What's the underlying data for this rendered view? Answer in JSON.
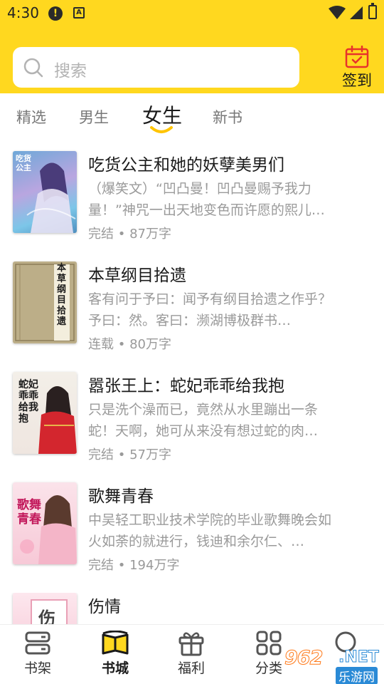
{
  "status_bar": {
    "time": "4:30",
    "alert_glyph": "!",
    "notify_glyph": "A"
  },
  "search": {
    "placeholder": "搜索",
    "icon": "search-icon"
  },
  "checkin": {
    "label": "签到",
    "icon": "calendar-check-icon"
  },
  "tabs": [
    {
      "label": "精选",
      "active": false
    },
    {
      "label": "男生",
      "active": false
    },
    {
      "label": "女生",
      "active": true
    },
    {
      "label": "新书",
      "active": false
    }
  ],
  "books": [
    {
      "title": "吃货公主和她的妖孽美男们",
      "description": "（爆笑文）“凹凸曼！凹凸曼赐予我力量！”神咒一出天地变色而许愿的熙儿…",
      "status": "完结",
      "words": "87万字",
      "cover_text": "吃货公主"
    },
    {
      "title": "本草纲目拾遗",
      "description": "客有问于予曰：闻予有纲目拾遗之作乎？予曰：然。客曰：濒湖博极群书…",
      "status": "连载",
      "words": "80万字",
      "cover_text": "本草纲目拾遗"
    },
    {
      "title": "嚣张王上：蛇妃乖乖给我抱",
      "description": "只是洗个澡而已，竟然从水里蹦出一条蛇！天啊，她可从来没有想过蛇的肉…",
      "status": "完结",
      "words": "57万字",
      "cover_text": "蛇妃乖乖给我抱"
    },
    {
      "title": "歌舞青春",
      "description": "中吴轻工职业技术学院的毕业歌舞晚会如火如荼的就进行，钱迪和余尔仁、…",
      "status": "完结",
      "words": "194万字",
      "cover_text": "歌舞青春"
    },
    {
      "title": "伤情",
      "description": "",
      "status": "",
      "words": "",
      "cover_text": "伤"
    }
  ],
  "meta_separator": "•",
  "bottom_nav": [
    {
      "label": "书架",
      "icon": "bookshelf-icon",
      "active": false
    },
    {
      "label": "书城",
      "icon": "bookstore-icon",
      "active": true
    },
    {
      "label": "福利",
      "icon": "gift-icon",
      "active": false
    },
    {
      "label": "分类",
      "icon": "grid-category-icon",
      "active": false
    },
    {
      "label": "",
      "icon": "search-icon",
      "active": false
    }
  ],
  "watermark": {
    "number": "962",
    "suffix": ".NET",
    "site": "乐游网"
  },
  "colors": {
    "brand_yellow": "#ffd81f",
    "text_primary": "#1a1a1a",
    "text_secondary": "#9a9a9a"
  }
}
